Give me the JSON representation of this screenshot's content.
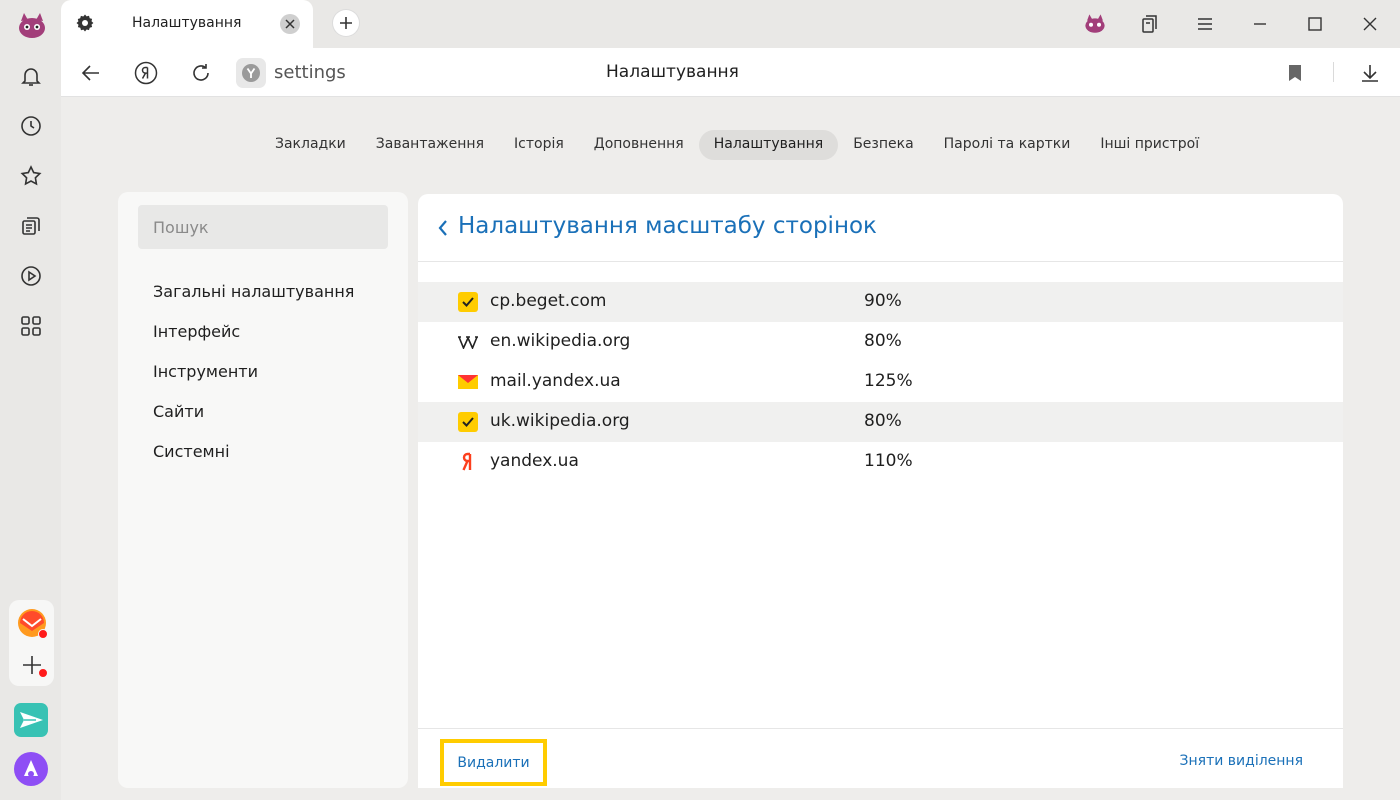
{
  "tab": {
    "title": "Налаштування",
    "icon": "gear-icon"
  },
  "addressbar": {
    "url": "settings",
    "page_title": "Налаштування"
  },
  "topnav": {
    "items": [
      {
        "label": "Закладки"
      },
      {
        "label": "Завантаження"
      },
      {
        "label": "Історія"
      },
      {
        "label": "Доповнення"
      },
      {
        "label": "Налаштування",
        "active": true
      },
      {
        "label": "Безпека"
      },
      {
        "label": "Паролі та картки"
      },
      {
        "label": "Інші пристрої"
      }
    ]
  },
  "leftpanel": {
    "search_placeholder": "Пошук",
    "menu": [
      {
        "label": "Загальні налаштування"
      },
      {
        "label": "Інтерфейс"
      },
      {
        "label": "Інструменти"
      },
      {
        "label": "Сайти"
      },
      {
        "label": "Системні"
      }
    ]
  },
  "main": {
    "title": "Налаштування масштабу сторінок",
    "rows": [
      {
        "domain": "cp.beget.com",
        "zoom": "90%",
        "checked": true,
        "icon": "checkbox-icon"
      },
      {
        "domain": "en.wikipedia.org",
        "zoom": "80%",
        "checked": false,
        "icon": "wikipedia-icon"
      },
      {
        "domain": "mail.yandex.ua",
        "zoom": "125%",
        "checked": false,
        "icon": "mail-icon"
      },
      {
        "domain": "uk.wikipedia.org",
        "zoom": "80%",
        "checked": true,
        "icon": "checkbox-icon"
      },
      {
        "domain": "yandex.ua",
        "zoom": "110%",
        "checked": false,
        "icon": "yandex-icon"
      }
    ],
    "delete_label": "Видалити",
    "unselect_label": "Зняти виділення"
  },
  "colors": {
    "accent": "#1a70b8",
    "highlight": "#ffcc00",
    "yandex_red": "#fc3f1d"
  }
}
